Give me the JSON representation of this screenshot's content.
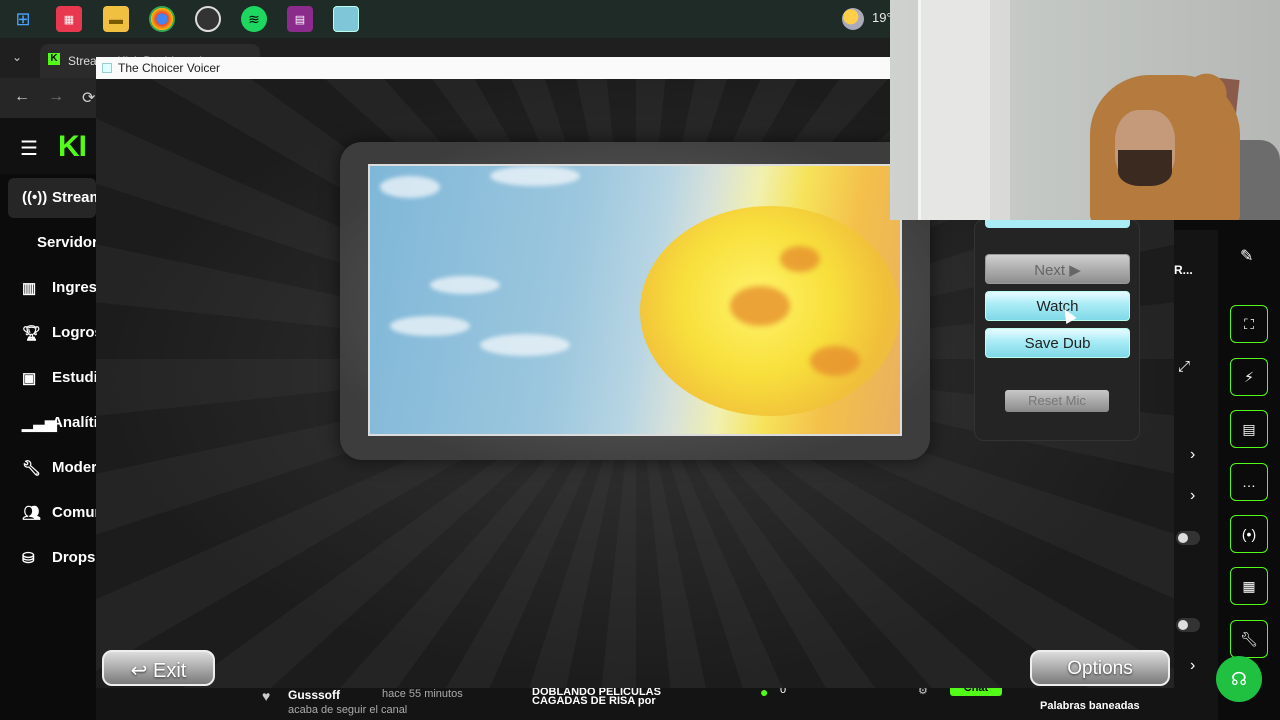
{
  "taskbar": {
    "icons": [
      "windows-start",
      "calculator",
      "file-explorer",
      "chrome",
      "obs",
      "spotify",
      "winrar",
      "app-window"
    ],
    "weather_temp": "19°"
  },
  "browser": {
    "tab_title": "Stream - Kick Dashboard"
  },
  "kick": {
    "logo": "KI",
    "sidebar": [
      {
        "label": "Stream",
        "icon": "broadcast-icon",
        "active": true
      },
      {
        "label": "Servidor",
        "icon": "",
        "active": false
      },
      {
        "label": "Ingresos",
        "icon": "money-icon",
        "active": false
      },
      {
        "label": "Logros",
        "icon": "trophy-icon",
        "active": false
      },
      {
        "label": "Estudio",
        "icon": "studio-icon",
        "active": false
      },
      {
        "label": "Analíticas",
        "icon": "analytics-icon",
        "active": false
      },
      {
        "label": "Moderación",
        "icon": "wrench-icon",
        "active": false
      },
      {
        "label": "Comunidad",
        "icon": "community-icon",
        "active": false
      },
      {
        "label": "Drops",
        "icon": "drops-icon",
        "active": false
      }
    ],
    "right_label": "R...",
    "bottom_bar": {
      "username": "Gusssoff",
      "time": "hace 55 minutos",
      "sub_text": "acaba de seguir el canal",
      "stream_title_line1": "DOBLANDO PELÍCULAS",
      "stream_title_line2": "CAGADAS DE RISA por",
      "viewers": "0",
      "chat_label": "Chat",
      "banned_words": "Palabras baneadas"
    }
  },
  "game": {
    "window_title": "The Choicer Voicer",
    "buttons": {
      "next": "Next ▶",
      "watch": "Watch",
      "save_dub": "Save Dub",
      "reset_mic": "Reset Mic",
      "exit": "Exit",
      "options": "Options"
    }
  },
  "colors": {
    "kick_green": "#53fc18",
    "button_cyan": "#a9ecf6"
  }
}
